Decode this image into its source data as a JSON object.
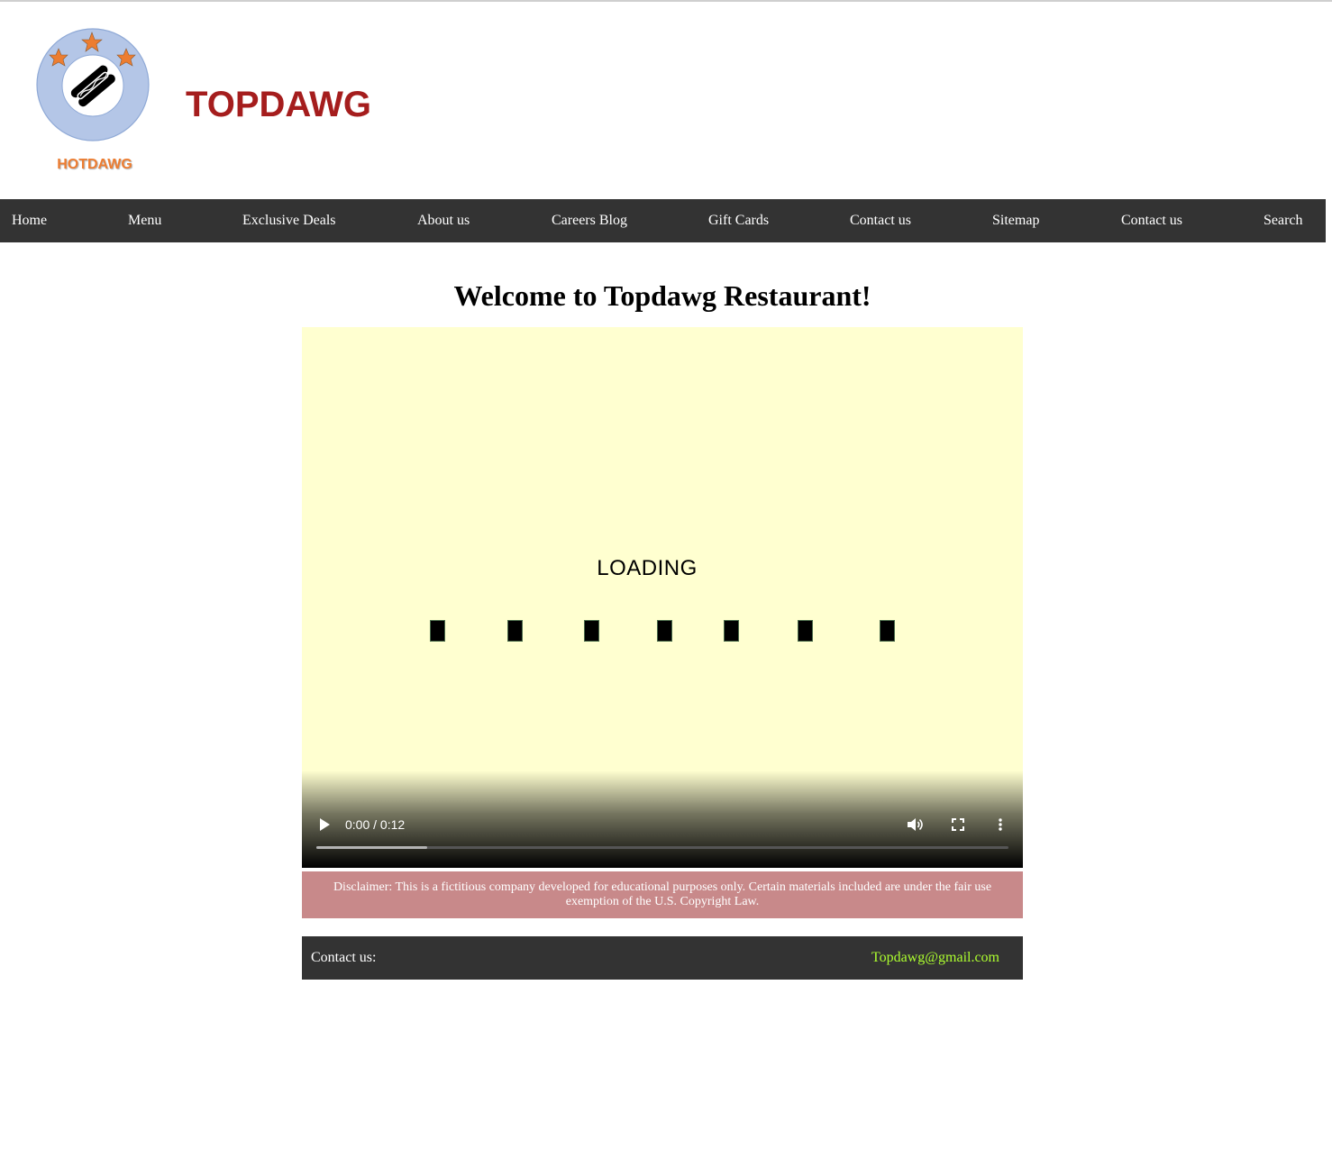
{
  "header": {
    "logo_text": "HOTDAWG",
    "brand_title": "TOPDAWG",
    "colors": {
      "brand": "#a51d1d",
      "logo_ring": "#b4c6e7",
      "logo_star": "#ed7d31"
    }
  },
  "nav": {
    "items": [
      {
        "label": "Home"
      },
      {
        "label": "Menu"
      },
      {
        "label": "Exclusive Deals"
      },
      {
        "label": "About us"
      },
      {
        "label": "Careers Blog"
      },
      {
        "label": "Gift Cards"
      },
      {
        "label": "Contact us"
      },
      {
        "label": "Sitemap"
      },
      {
        "label": "Contact us"
      },
      {
        "label": "Search"
      }
    ],
    "background": "#333333"
  },
  "main": {
    "heading": "Welcome to Topdawg Restaurant!",
    "video": {
      "loading_text": "LOADING",
      "time": "0:00 / 0:12",
      "buffered_fraction": 0.16,
      "background": "#ffffd0",
      "icons": [
        "play-icon",
        "volume-icon",
        "fullscreen-icon",
        "more-options-icon"
      ]
    }
  },
  "disclaimer": {
    "text": "Disclaimer: This is a fictitious company developed for educational purposes only. Certain materials included are under the fair use exemption of the U.S. Copyright Law.",
    "background": "#c8898a"
  },
  "footer": {
    "contact_label": "Contact us:",
    "email": "Topdawg@gmail.com",
    "email_color": "#adff2f"
  }
}
